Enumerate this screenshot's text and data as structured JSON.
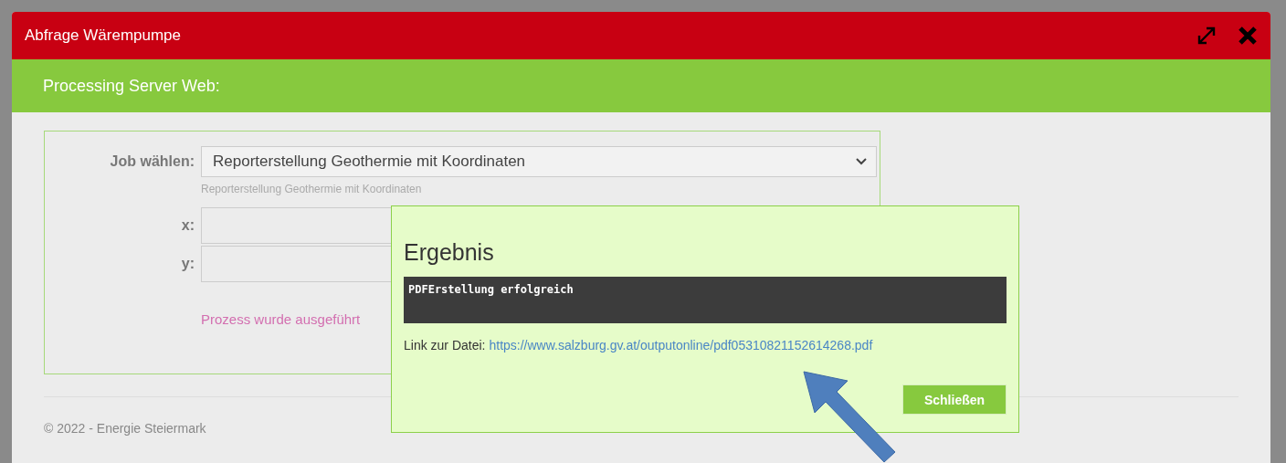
{
  "window": {
    "title": "Abfrage Wärempumpe"
  },
  "header": {
    "title": "Processing Server Web:"
  },
  "form": {
    "job_label": "Job wählen:",
    "job_value": "Reporterstellung Geothermie mit Koordinaten",
    "job_hint": "Reporterstellung Geothermie mit Koordinaten",
    "fields": [
      {
        "label": "x:"
      },
      {
        "label": "y:"
      }
    ],
    "status": "Prozess wurde ausgeführt"
  },
  "result": {
    "title": "Ergebnis",
    "output": "PDFErstellung erfolgreich",
    "link_label": "Link zur Datei:",
    "link_url": "https://www.salzburg.gv.at/outputonline/pdf05310821152614268.pdf",
    "button": "Schließen"
  },
  "footer": "© 2022 - Energie Steiermark"
}
